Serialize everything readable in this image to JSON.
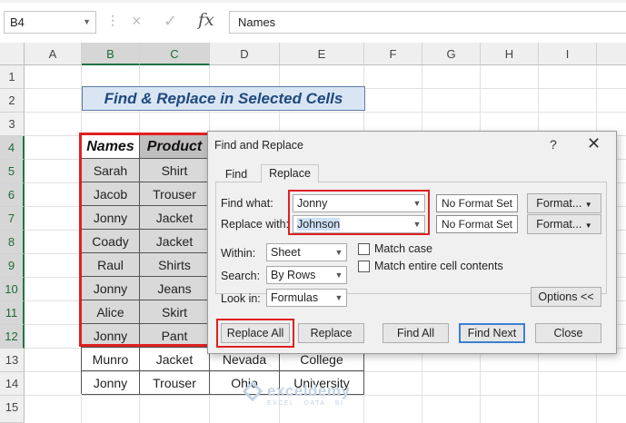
{
  "formula_bar": {
    "name_box": "B4",
    "cancel_icon": "×",
    "enter_icon": "✓",
    "fx_label": "fx",
    "value": "Names"
  },
  "columns": [
    "A",
    "B",
    "C",
    "D",
    "E",
    "F",
    "G",
    "H",
    "I"
  ],
  "rows": [
    "1",
    "2",
    "3",
    "4",
    "5",
    "6",
    "7",
    "8",
    "9",
    "10",
    "11",
    "12",
    "13",
    "14",
    "15"
  ],
  "sheet_title": "Find & Replace in Selected Cells",
  "table": {
    "headers": [
      "Names",
      "Product"
    ],
    "rows": [
      [
        "Sarah",
        "Shirt"
      ],
      [
        "Jacob",
        "Trouser"
      ],
      [
        "Jonny",
        "Jacket"
      ],
      [
        "Coady",
        "Jacket"
      ],
      [
        "Raul",
        "Shirts"
      ],
      [
        "Jonny",
        "Jeans"
      ],
      [
        "Alice",
        "Skirt"
      ],
      [
        "Jonny",
        "Pant"
      ],
      [
        "Munro",
        "Jacket",
        "Nevada",
        "College"
      ],
      [
        "Jonny",
        "Trouser",
        "Ohio",
        "University"
      ]
    ]
  },
  "dialog": {
    "title": "Find and Replace",
    "help": "?",
    "close": "✕",
    "tabs": [
      "Find",
      "Replace"
    ],
    "find_what_label": "Find what:",
    "find_what_value": "Jonny",
    "replace_with_label": "Replace with:",
    "replace_with_value": "Johnson",
    "no_format_set": "No Format Set",
    "format_button": "Format...",
    "within_label": "Within:",
    "within_value": "Sheet",
    "search_label": "Search:",
    "search_value": "By Rows",
    "look_in_label": "Look in:",
    "look_in_value": "Formulas",
    "match_case": "Match case",
    "match_entire": "Match entire cell contents",
    "options_button": "Options <<",
    "replace_all": "Replace All",
    "replace": "Replace",
    "find_all": "Find All",
    "find_next": "Find Next",
    "close_button": "Close"
  },
  "watermark": {
    "name": "exceldemy",
    "tagline": "EXCEL · DATA · BI"
  }
}
